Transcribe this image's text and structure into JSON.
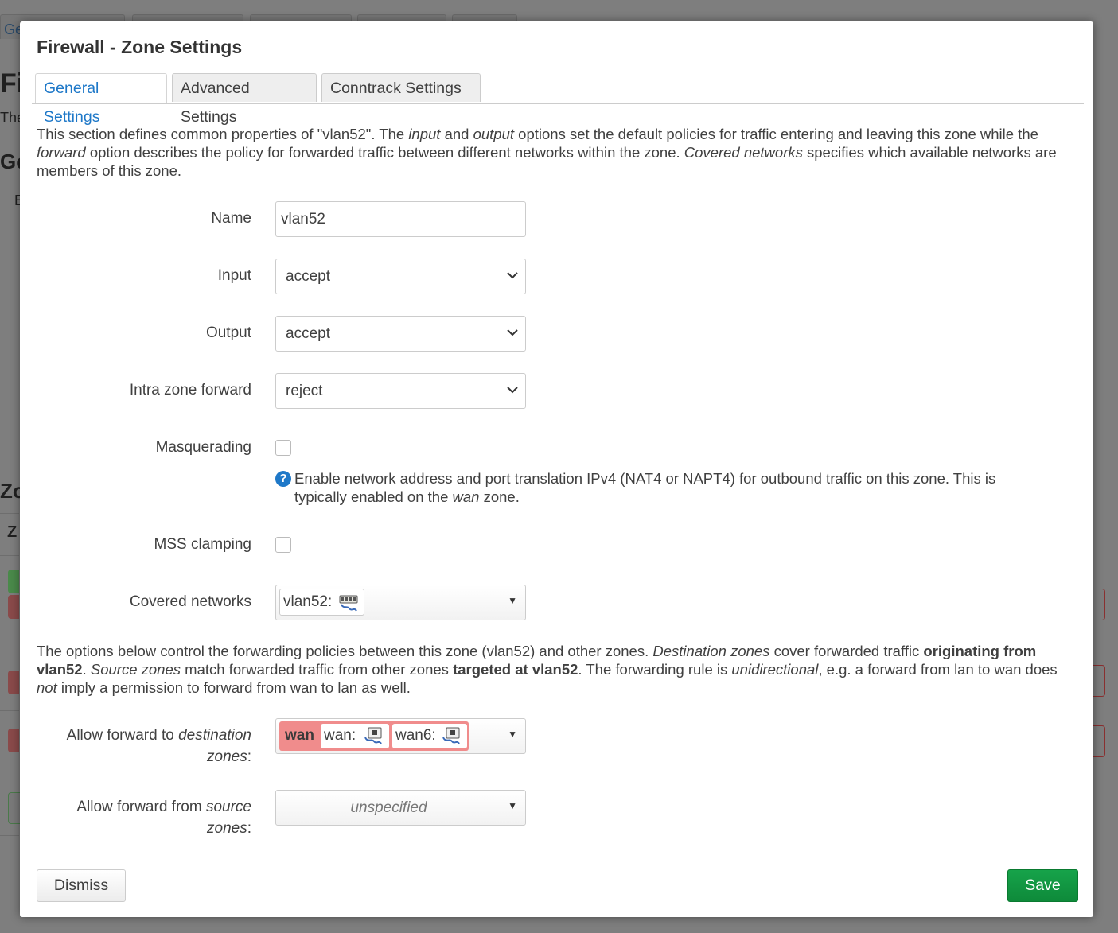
{
  "background_page": {
    "tab_fragment": "Ge",
    "title_fragment": "Fi",
    "subtitle_fragment": "The",
    "section_fragment": "Ge",
    "line_fragment": "E",
    "zones_heading_fragment": "Zo",
    "zones_col_fragment": "Z"
  },
  "modal": {
    "title": "Firewall - Zone Settings",
    "tabs": [
      {
        "label": "General Settings",
        "active": true
      },
      {
        "label": "Advanced Settings",
        "active": false
      },
      {
        "label": "Conntrack Settings",
        "active": false
      }
    ],
    "intro": {
      "p1": "This section defines common properties of \"vlan52\". The ",
      "i1": "input",
      "p2": " and ",
      "i2": "output",
      "p3": " options set the default policies for traffic entering and leaving this zone while the ",
      "i3": "forward",
      "p4": " option describes the policy for forwarded traffic between different networks within the zone. ",
      "i4": "Covered networks",
      "p5": " specifies which available networks are members of this zone."
    },
    "fields": {
      "name": {
        "label": "Name",
        "value": "vlan52"
      },
      "input": {
        "label": "Input",
        "value": "accept"
      },
      "output": {
        "label": "Output",
        "value": "accept"
      },
      "intra_zone_forward": {
        "label": "Intra zone forward",
        "value": "reject"
      },
      "masquerading": {
        "label": "Masquerading",
        "checked": false,
        "help": {
          "p1": "Enable network address and port translation IPv4 (NAT4 or NAPT4) for outbound traffic on this zone. This is typically enabled on the ",
          "i1": "wan",
          "p2": " zone."
        }
      },
      "mss_clamping": {
        "label": "MSS clamping",
        "checked": false
      },
      "covered_networks": {
        "label": "Covered networks",
        "chip": "vlan52:",
        "icon": "network-ethernet-icon"
      }
    },
    "forwarding_intro": {
      "p1": "The options below control the forwarding policies between this zone (vlan52) and other zones. ",
      "i1": "Destination zones",
      "p2": " cover forwarded traffic ",
      "b1": "originating from vlan52",
      "p3": ". ",
      "i2": "Source zones",
      "p4": " match forwarded traffic from other zones ",
      "b2": "targeted at vlan52",
      "p5": ". The forwarding rule is ",
      "i3": "unidirectional",
      "p6": ", e.g. a forward from lan to wan does ",
      "i4": "not",
      "p7": " imply a permission to forward from wan to lan as well."
    },
    "forward_to": {
      "label_pre": "Allow forward to ",
      "label_em": "destination",
      "label_line2_em": "zones",
      "label_line2_post": ":",
      "zone": "wan",
      "zone_color": "#f08c8c",
      "chips": [
        "wan:",
        "wan6:"
      ]
    },
    "forward_from": {
      "label_pre": "Allow forward from ",
      "label_em": "source",
      "label_line2_em": "zones",
      "label_line2_post": ":",
      "placeholder": "unspecified"
    },
    "buttons": {
      "dismiss": "Dismiss",
      "save": "Save"
    }
  }
}
